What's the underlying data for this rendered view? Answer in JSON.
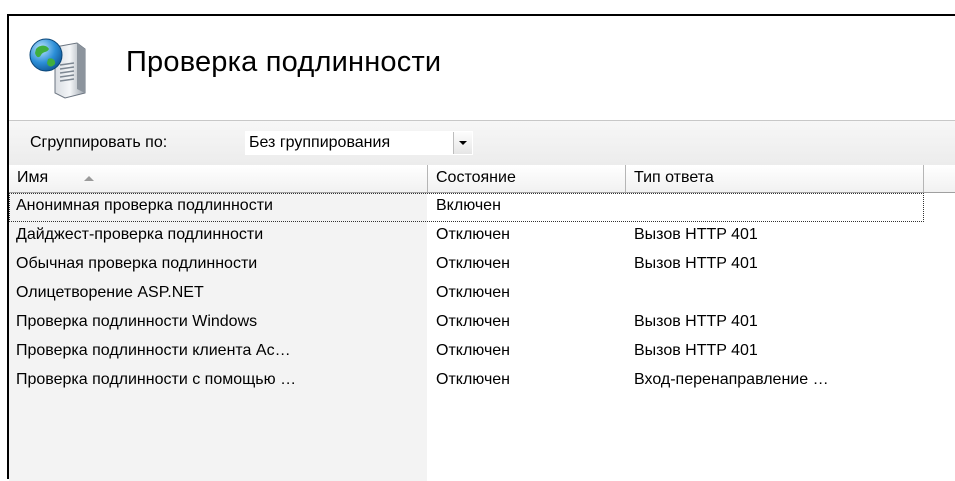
{
  "page": {
    "title": "Проверка подлинности",
    "icon": "server-globe-icon"
  },
  "grouping": {
    "label": "Сгруппировать по:",
    "value": "Без группирования"
  },
  "table": {
    "columns": [
      {
        "label": "Имя",
        "sort": "ascending"
      },
      {
        "label": "Состояние"
      },
      {
        "label": "Тип ответа"
      }
    ],
    "rows": [
      {
        "name": "Анонимная проверка подлинности",
        "state": "Включен",
        "response": "",
        "selected": true
      },
      {
        "name": "Дайджест-проверка подлинности",
        "state": "Отключен",
        "response": "Вызов HTTP 401"
      },
      {
        "name": "Обычная проверка подлинности",
        "state": "Отключен",
        "response": "Вызов HTTP 401"
      },
      {
        "name": "Олицетворение ASP.NET",
        "state": "Отключен",
        "response": ""
      },
      {
        "name": "Проверка подлинности Windows",
        "state": "Отключен",
        "response": "Вызов HTTP 401"
      },
      {
        "name": "Проверка подлинности клиента Ac…",
        "state": "Отключен",
        "response": "Вызов HTTP 401"
      },
      {
        "name": "Проверка подлинности с помощью …",
        "state": "Отключен",
        "response": "Вход-перенаправление …"
      }
    ]
  },
  "colors": {
    "name_column_bg": "#f3f3f3",
    "header_bg": "#f1f1f1",
    "border": "#a0a0a0"
  }
}
